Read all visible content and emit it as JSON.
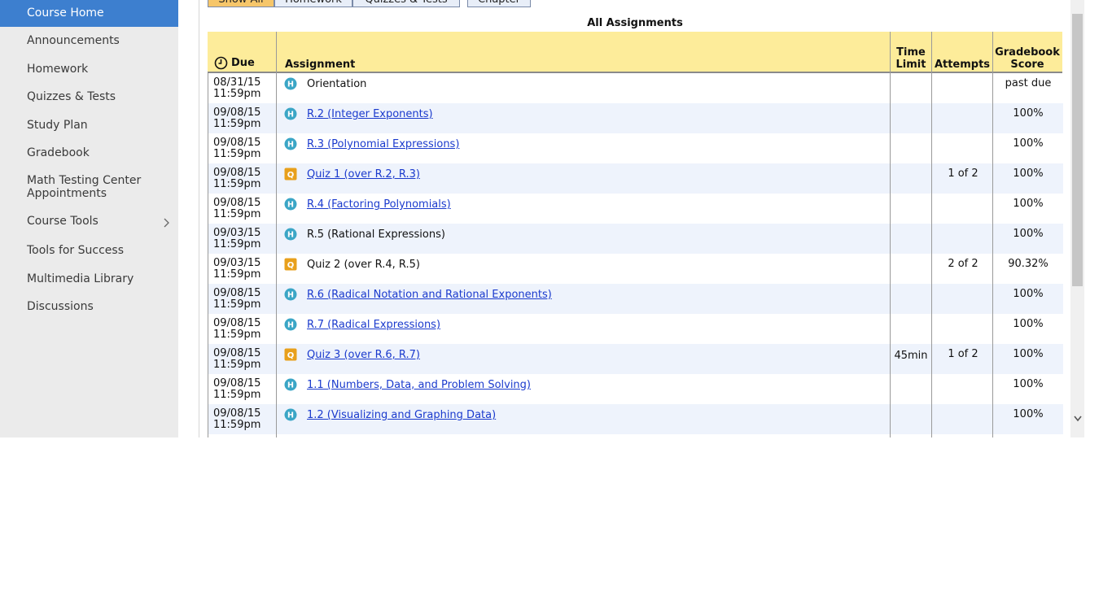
{
  "sidebar": {
    "items": [
      {
        "label": "Course Home",
        "active": true
      },
      {
        "label": "Announcements"
      },
      {
        "label": "Homework"
      },
      {
        "label": "Quizzes & Tests"
      },
      {
        "label": "Study Plan"
      },
      {
        "label": "Gradebook"
      },
      {
        "label": "Math Testing Center Appointments"
      },
      {
        "label": "Course Tools",
        "has_submenu": true
      },
      {
        "label": "Tools for Success"
      },
      {
        "label": "Multimedia Library"
      },
      {
        "label": "Discussions"
      }
    ]
  },
  "filters": {
    "show_all": "Show All",
    "homework": "Homework",
    "quizzes_tests": "Quizzes & Tests",
    "chapter": "Chapter"
  },
  "table": {
    "title": "All Assignments",
    "headers": {
      "due": "Due",
      "assignment": "Assignment",
      "time_limit_1": "Time",
      "time_limit_2": "Limit",
      "attempts": "Attempts",
      "gradebook_1": "Gradebook",
      "gradebook_2": "Score"
    },
    "rows": [
      {
        "date": "08/31/15",
        "time": "11:59pm",
        "type": "H",
        "name": "Orientation",
        "link": false,
        "time_limit": "",
        "attempts": "",
        "score": "past due"
      },
      {
        "date": "09/08/15",
        "time": "11:59pm",
        "type": "H",
        "name": "R.2 (Integer Exponents)",
        "link": true,
        "time_limit": "",
        "attempts": "",
        "score": "100%"
      },
      {
        "date": "09/08/15",
        "time": "11:59pm",
        "type": "H",
        "name": "R.3 (Polynomial Expressions)",
        "link": true,
        "time_limit": "",
        "attempts": "",
        "score": "100%"
      },
      {
        "date": "09/08/15",
        "time": "11:59pm",
        "type": "Q",
        "name": "Quiz 1 (over R.2, R.3)",
        "link": true,
        "time_limit": "",
        "attempts": "1 of 2",
        "score": "100%"
      },
      {
        "date": "09/08/15",
        "time": "11:59pm",
        "type": "H",
        "name": "R.4 (Factoring Polynomials)",
        "link": true,
        "time_limit": "",
        "attempts": "",
        "score": "100%"
      },
      {
        "date": "09/03/15",
        "time": "11:59pm",
        "type": "H",
        "name": "R.5 (Rational Expressions)",
        "link": false,
        "time_limit": "",
        "attempts": "",
        "score": "100%"
      },
      {
        "date": "09/03/15",
        "time": "11:59pm",
        "type": "Q",
        "name": "Quiz 2 (over R.4, R.5)",
        "link": false,
        "time_limit": "",
        "attempts": "2 of 2",
        "score": "90.32%"
      },
      {
        "date": "09/08/15",
        "time": "11:59pm",
        "type": "H",
        "name": "R.6 (Radical Notation and Rational Exponents)",
        "link": true,
        "time_limit": "",
        "attempts": "",
        "score": "100%"
      },
      {
        "date": "09/08/15",
        "time": "11:59pm",
        "type": "H",
        "name": "R.7 (Radical Expressions)",
        "link": true,
        "time_limit": "",
        "attempts": "",
        "score": "100%"
      },
      {
        "date": "09/08/15",
        "time": "11:59pm",
        "type": "Q",
        "name": "Quiz 3 (over R.6, R.7)",
        "link": true,
        "time_limit": "45min",
        "attempts": "1 of 2",
        "score": "100%"
      },
      {
        "date": "09/08/15",
        "time": "11:59pm",
        "type": "H",
        "name": "1.1 (Numbers, Data, and Problem Solving)",
        "link": true,
        "time_limit": "",
        "attempts": "",
        "score": "100%"
      },
      {
        "date": "09/08/15",
        "time": "11:59pm",
        "type": "H",
        "name": "1.2 (Visualizing and Graphing Data)",
        "link": true,
        "time_limit": "",
        "attempts": "",
        "score": "100%"
      }
    ]
  },
  "colors": {
    "active_nav": "#3d7fcf",
    "header_bg": "#fdec9a",
    "row_alt": "#eef3fc",
    "homework_badge": "#3ba6c6",
    "quiz_badge": "#e8a01c",
    "link": "#1a3acd"
  }
}
